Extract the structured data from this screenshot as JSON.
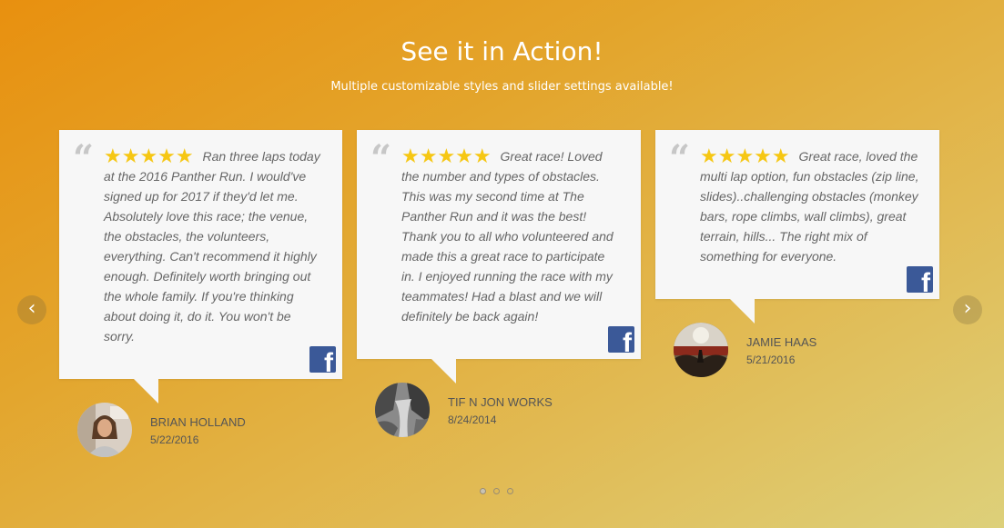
{
  "header": {
    "title": "See it in Action!",
    "subtitle": "Multiple customizable styles and slider settings available!"
  },
  "reviews": [
    {
      "stars": "★★★★★",
      "rating": 5,
      "text": "Ran three laps today at the 2016 Panther Run. I would've signed up for 2017 if they'd let me. Absolutely love this race; the venue, the obstacles, the volunteers, everything. Can't recommend it highly enough. Definitely worth bringing out the whole family. If you're thinking about doing it, do it. You won't be sorry.",
      "author": "BRIAN HOLLAND",
      "date": "5/22/2016",
      "source_icon": "facebook-icon"
    },
    {
      "stars": "★★★★★",
      "rating": 5,
      "text": "Great race! Loved the number and types of obstacles. This was my second time at The Panther Run and it was the best! Thank you to all who volunteered and made this a great race to participate in. I enjoyed running the race with my teammates! Had a blast and we will definitely be back again!",
      "author": "TIF N JON WORKS",
      "date": "8/24/2014",
      "source_icon": "facebook-icon"
    },
    {
      "stars": "★★★★★",
      "rating": 5,
      "text": "Great race, loved the multi lap option, fun obstacles (zip line, slides)..challenging obstacles (monkey bars, rope climbs, wall climbs), great terrain, hills... The right mix of something for everyone.",
      "author": "JAMIE HAAS",
      "date": "5/21/2016",
      "source_icon": "facebook-icon"
    }
  ],
  "navigation": {
    "prev_icon": "‹",
    "next_icon": "›",
    "pages": 3,
    "active_page": 1
  },
  "colors": {
    "background_start": "#e8900f",
    "background_end": "#ddd07a",
    "star": "#f6c713",
    "facebook": "#3b5998"
  }
}
